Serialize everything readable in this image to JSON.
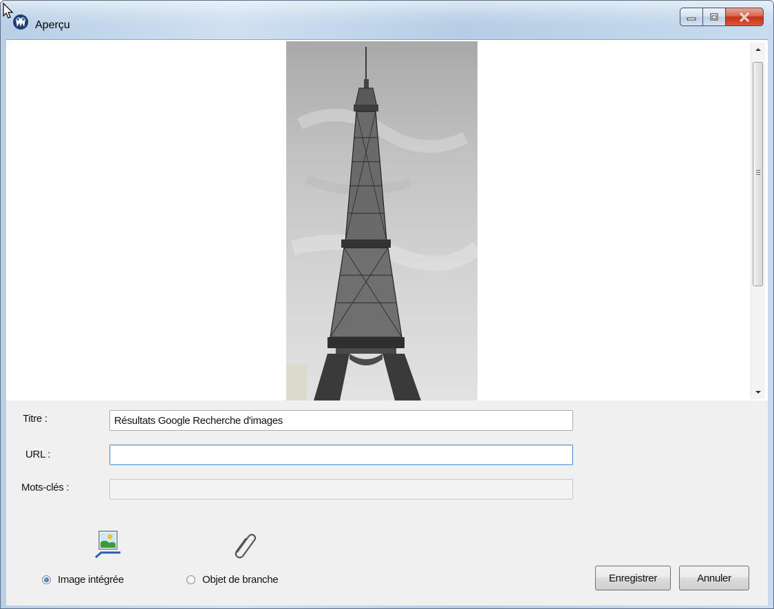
{
  "window": {
    "title": "Aperçu",
    "accent_close": "#c4331a",
    "titlebar_color": "#b8cfe6"
  },
  "preview": {
    "image_subject": "eiffel-tower-photo",
    "scrollbar": {
      "position_fraction": 0.0,
      "visible_fraction": 0.63
    }
  },
  "form": {
    "title_label": "Titre :",
    "title_value": "Résultats Google Recherche d'images",
    "url_label": "URL :",
    "url_value": "",
    "keywords_label": "Mots-clés :",
    "keywords_value": ""
  },
  "options": {
    "embedded_label": "Image intégrée",
    "branch_object_label": "Objet de branche",
    "selected": "embedded",
    "embedded_icon": "picture-icon",
    "branch_icon": "paperclip-icon"
  },
  "buttons": {
    "save_label": "Enregistrer",
    "cancel_label": "Annuler"
  }
}
